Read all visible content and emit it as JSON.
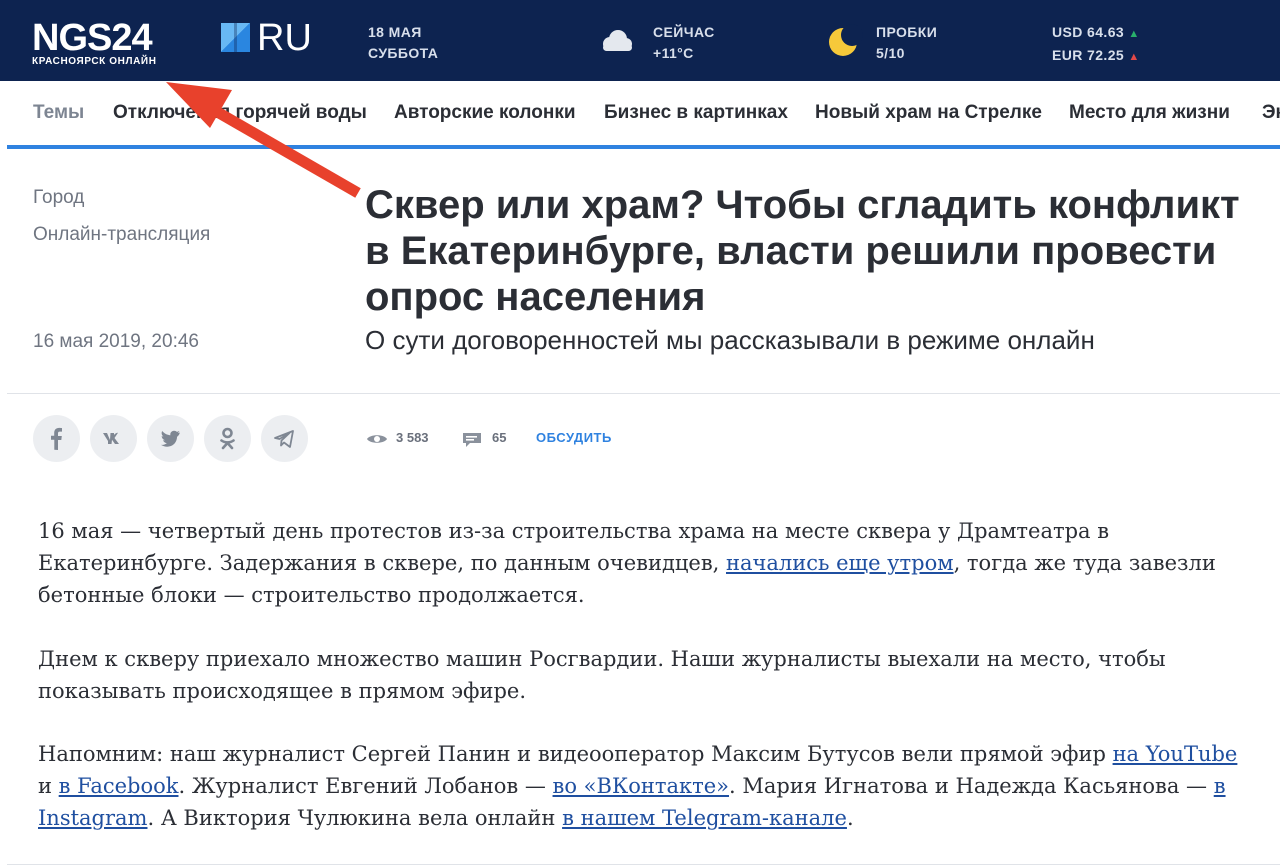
{
  "header": {
    "logo_main": "NGS24",
    "logo_tld": "RU",
    "logo_sub": "КРАСНОЯРСК ОНЛАЙН",
    "date_line1": "18 МАЯ",
    "date_line2": "СУББОТА",
    "weather_label": "СЕЙЧАС",
    "weather_value": "+11°C",
    "weather_icon": "cloud-icon",
    "traffic_label": "ПРОБКИ",
    "traffic_value": "5/10",
    "traffic_icon": "traffic-icon",
    "usd": "USD 64.63",
    "eur": "EUR 72.25",
    "usd_trend": "▲",
    "eur_trend": "▲",
    "colors": {
      "bar": "#0d2350",
      "accent": "#2f82e0",
      "up": "#29b06b",
      "down": "#e24848"
    }
  },
  "nav": {
    "items": [
      "Темы",
      "Отключения горячей воды",
      "Авторские колонки",
      "Бизнес в картинках",
      "Новый храм на Стрелке",
      "Место для жизни",
      "Эк"
    ]
  },
  "article": {
    "rubric1": "Город",
    "rubric2": "Онлайн-трансляция",
    "date": "16 мая 2019, 20:46",
    "title": "Сквер или храм? Чтобы сгладить конфликт в Екатеринбурге, власти решили провести опрос населения",
    "subtitle": "О сути договоренностей мы рассказывали в режиме онлайн",
    "views": "3 583",
    "comments": "65",
    "discuss": "ОБСУДИТЬ",
    "share_icons": [
      "facebook-icon",
      "vk-icon",
      "twitter-icon",
      "odnoklassniki-icon",
      "telegram-icon"
    ],
    "p1_a": "16 мая — четвертый день протестов из-за строительства храма на месте сквера у Драмтеатра в Екатеринбурге. Задержания в сквере, по данным очевидцев, ",
    "p1_link": "начались еще утром",
    "p1_b": ", тогда же туда завезли бетонные блоки — строительство продолжается.",
    "p2": "Днем к скверу приехало множество машин Росгвардии. Наши журналисты выехали на место, чтобы показывать происходящее в прямом эфире.",
    "p3_a": "Напомним: наш журналист Сергей Панин и видеооператор Максим Бутусов вели прямой эфир ",
    "p3_link1": "на YouTube",
    "p3_b": " и ",
    "p3_link2": "в Facebook",
    "p3_c": ". Журналист Евгений Лобанов — ",
    "p3_link3": "во «ВКонтакте»",
    "p3_d": ". Мария Игнатова и Надежда Касьянова — ",
    "p3_link4": "в Instagram",
    "p3_e": ". А Виктория Чулюкина вела онлайн ",
    "p3_link5": "в нашем Telegram-канале",
    "p3_f": "."
  }
}
